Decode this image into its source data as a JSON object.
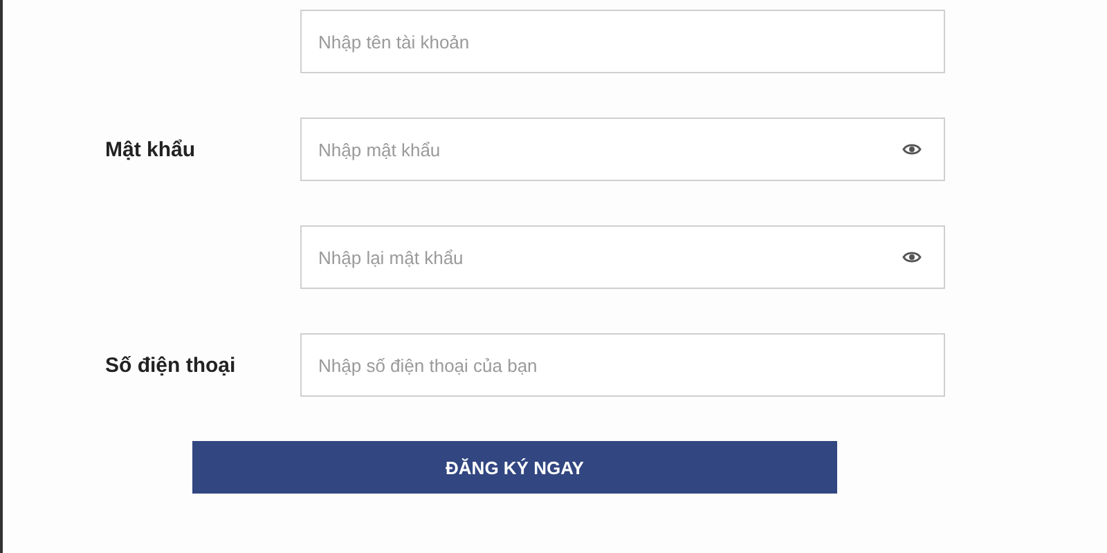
{
  "form": {
    "fields": [
      {
        "kind": "text",
        "placeholder": "Nhập tên tài khoản"
      },
      {
        "kind": "password",
        "label": "Mật khẩu",
        "placeholder": "Nhập mật khẩu"
      },
      {
        "kind": "password",
        "placeholder": "Nhập lại mật khẩu"
      },
      {
        "kind": "text",
        "label": "Số điện thoại",
        "placeholder": "Nhập số điện thoại của bạn"
      }
    ],
    "submit": "ĐĂNG KÝ NGAY"
  }
}
